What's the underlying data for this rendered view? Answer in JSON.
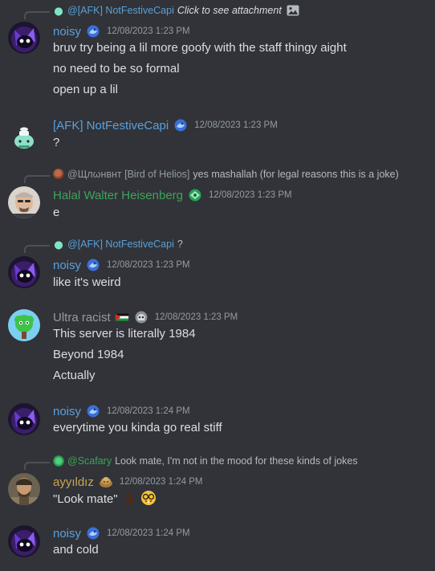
{
  "messages": [
    {
      "reply": {
        "name": "@[AFK] NotFestiveCapi",
        "text": "Click to see attachment",
        "icon": "image-icon"
      },
      "author": "noisy",
      "timestamp": "12/08/2023 1:23 PM",
      "lines": [
        "bruv try being a lil more goofy with the staff thingy aight",
        "no need to be so formal",
        "open up a lil"
      ]
    },
    {
      "author": "[AFK] NotFestiveCapi",
      "timestamp": "12/08/2023 1:23 PM",
      "lines": [
        "?"
      ]
    },
    {
      "reply": {
        "name": "@Щлωнвнт [Bird of Helios]",
        "text": "yes mashallah (for legal reasons this is a joke)"
      },
      "author": "Halal Walter Heisenberg",
      "timestamp": "12/08/2023 1:23 PM",
      "lines": [
        "e"
      ]
    },
    {
      "reply": {
        "name": "@[AFK] NotFestiveCapi",
        "text": "?"
      },
      "author": "noisy",
      "timestamp": "12/08/2023 1:23 PM",
      "lines": [
        "like it's weird"
      ]
    },
    {
      "author": "Ultra racist",
      "timestamp": "12/08/2023 1:23 PM",
      "lines": [
        "This server is literally 1984",
        "Beyond 1984",
        "Actually"
      ]
    },
    {
      "author": "noisy",
      "timestamp": "12/08/2023 1:24 PM",
      "lines": [
        "everytime you kinda go real stiff"
      ]
    },
    {
      "reply": {
        "name": "@Scafary",
        "text": "Look mate, I'm not in the mood for these kinds of jokes"
      },
      "author": "ayyıldız",
      "timestamp": "12/08/2023 1:24 PM",
      "lines": [
        "\"Look mate\""
      ]
    },
    {
      "author": "noisy",
      "timestamp": "12/08/2023 1:24 PM",
      "lines": [
        "and cold"
      ]
    }
  ],
  "colors": {
    "background": "#313338",
    "blue_name": "#5aa0de",
    "green_name": "#3ba55c",
    "gray_name": "#949ba4",
    "gold_name": "#c9a654"
  }
}
